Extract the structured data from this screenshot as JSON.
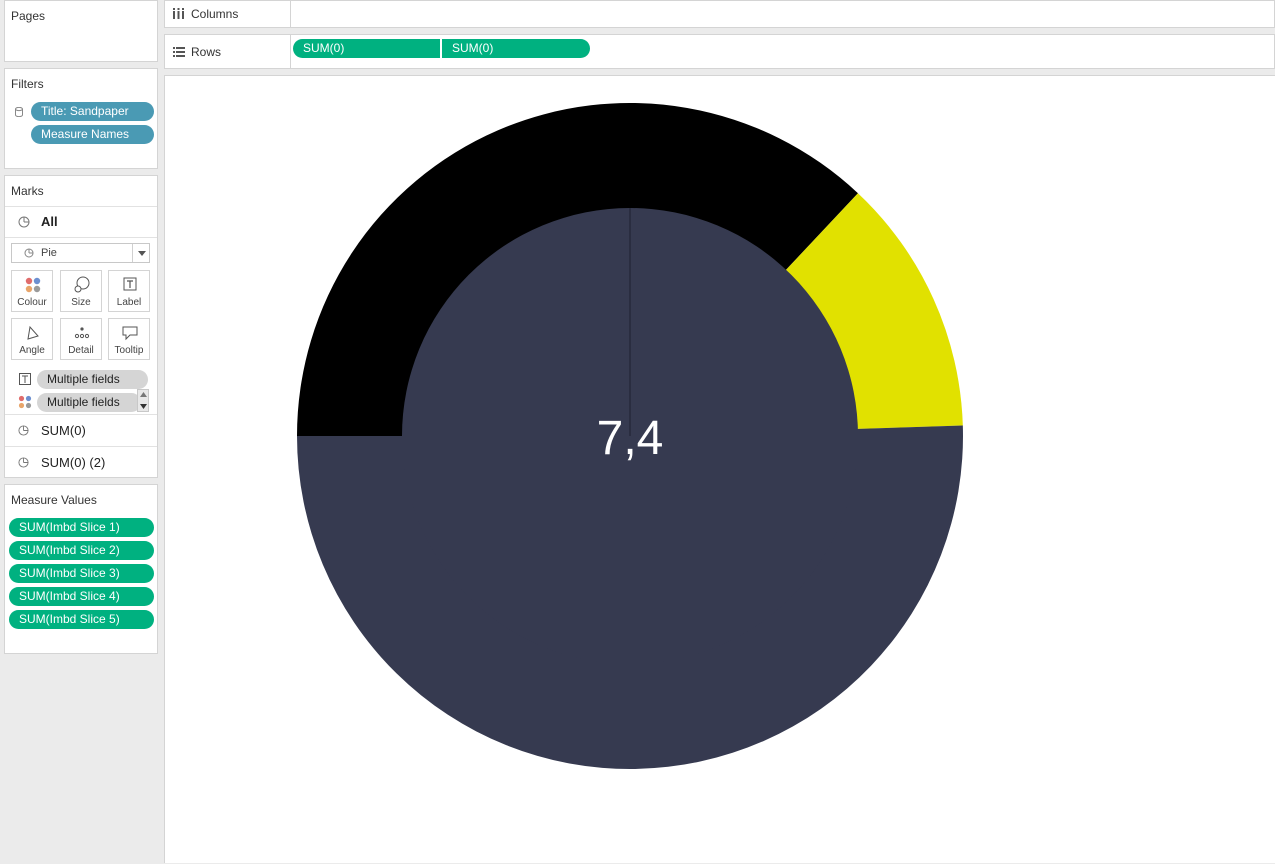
{
  "pages": {
    "title": "Pages"
  },
  "filters": {
    "title": "Filters",
    "items": [
      {
        "label": "Title: Sandpaper"
      },
      {
        "label": "Measure Names"
      }
    ]
  },
  "marks": {
    "title": "Marks",
    "all_label": "All",
    "mark_type": "Pie",
    "buttons": [
      {
        "label": "Colour",
        "icon": "colour-icon"
      },
      {
        "label": "Size",
        "icon": "size-icon"
      },
      {
        "label": "Label",
        "icon": "label-icon"
      },
      {
        "label": "Angle",
        "icon": "angle-icon"
      },
      {
        "label": "Detail",
        "icon": "detail-icon"
      },
      {
        "label": "Tooltip",
        "icon": "tooltip-icon"
      }
    ],
    "fields": [
      {
        "label": "Multiple fields",
        "icon": "label-icon"
      },
      {
        "label": "Multiple fields",
        "icon": "colour-icon"
      }
    ],
    "layers": [
      {
        "label": "SUM(0)"
      },
      {
        "label": "SUM(0) (2)"
      }
    ]
  },
  "measure_values": {
    "title": "Measure Values",
    "items": [
      {
        "label": "SUM(Imbd Slice 1)"
      },
      {
        "label": "SUM(Imbd Slice 2)"
      },
      {
        "label": "SUM(Imbd Slice 3)"
      },
      {
        "label": "SUM(Imbd Slice 4)"
      },
      {
        "label": "SUM(Imbd Slice 5)"
      }
    ]
  },
  "shelves": {
    "columns_label": "Columns",
    "rows_label": "Rows",
    "rows_pills": [
      "SUM(0)",
      "SUM(0)"
    ]
  },
  "chart": {
    "center_label": "7,4",
    "colors": {
      "background": "#363a50",
      "filled": "#000000",
      "highlight": "#e1e100"
    }
  },
  "chart_data": {
    "type": "pie",
    "title": "",
    "center_label": "7,4",
    "slices": [
      {
        "value": 3.7,
        "color": "#000000"
      },
      {
        "value": 1.25,
        "color": "#e1e100"
      },
      {
        "value": 5.05,
        "color": "#363a50"
      }
    ]
  }
}
